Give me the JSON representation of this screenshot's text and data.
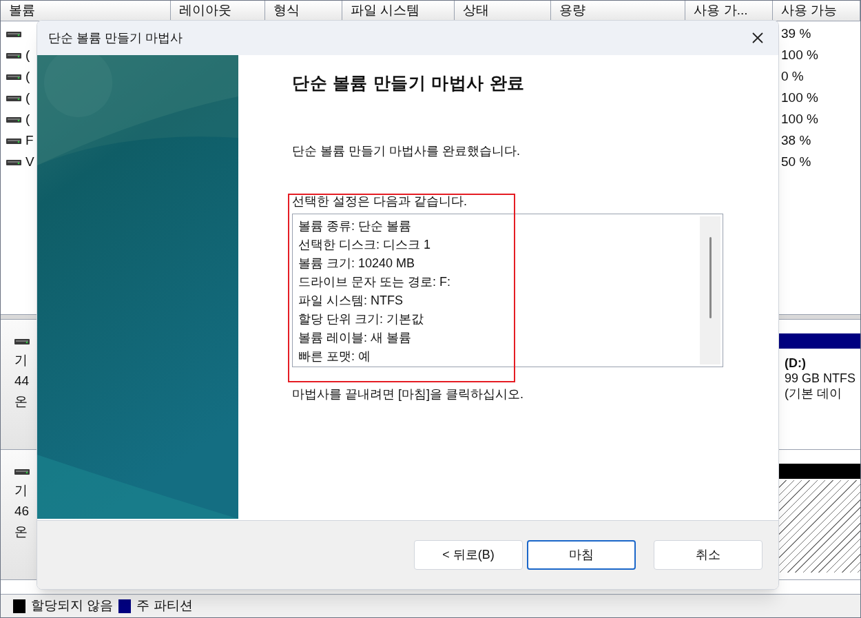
{
  "volume_list": {
    "columns": [
      "볼륨",
      "레이아웃",
      "형식",
      "파일 시스템",
      "상태",
      "용량",
      "사용 가...",
      "사용 가능"
    ],
    "rows": [
      {
        "percent_free": "39 %"
      },
      {
        "name": "(",
        "percent_free": "100 %"
      },
      {
        "name": "(",
        "percent_free": "0 %"
      },
      {
        "name": "(",
        "percent_free": "100 %"
      },
      {
        "name": "(",
        "percent_free": "100 %"
      },
      {
        "name": "F",
        "percent_free": "38 %"
      },
      {
        "name": "V",
        "percent_free": "50 %"
      }
    ]
  },
  "disks": [
    {
      "lines": [
        "기",
        "44",
        "온"
      ],
      "partition": {
        "kind": "primary",
        "lines": [
          "(D:)",
          "99 GB NTFS",
          "(기본 데이"
        ]
      }
    },
    {
      "lines": [
        "기",
        "46",
        "온"
      ],
      "partition": {
        "kind": "unallocated"
      }
    }
  ],
  "legend": [
    {
      "label": "할당되지 않음",
      "color": "#000000"
    },
    {
      "label": "주 파티션",
      "color": "#000080"
    }
  ],
  "dialog": {
    "title": "단순 볼륨 만들기 마법사",
    "heading": "단순 볼륨 만들기 마법사 완료",
    "intro": "단순 볼륨 만들기 마법사를 완료했습니다.",
    "settings_label": "선택한 설정은 다음과 같습니다.",
    "settings": [
      "볼륨 종류: 단순 볼륨",
      "선택한 디스크: 디스크 1",
      "볼륨 크기: 10240 MB",
      "드라이브 문자 또는 경로: F:",
      "파일 시스템: NTFS",
      "할당 단위 크기: 기본값",
      "볼륨 레이블: 새 볼륨",
      "빠른 포맷: 예"
    ],
    "closing": "마법사를 끝내려면 [마침]을 클릭하십시오.",
    "buttons": [
      {
        "label": "< 뒤로(B)",
        "default": false
      },
      {
        "label": "마침",
        "default": true
      },
      {
        "label": "취소",
        "default": false
      }
    ]
  }
}
